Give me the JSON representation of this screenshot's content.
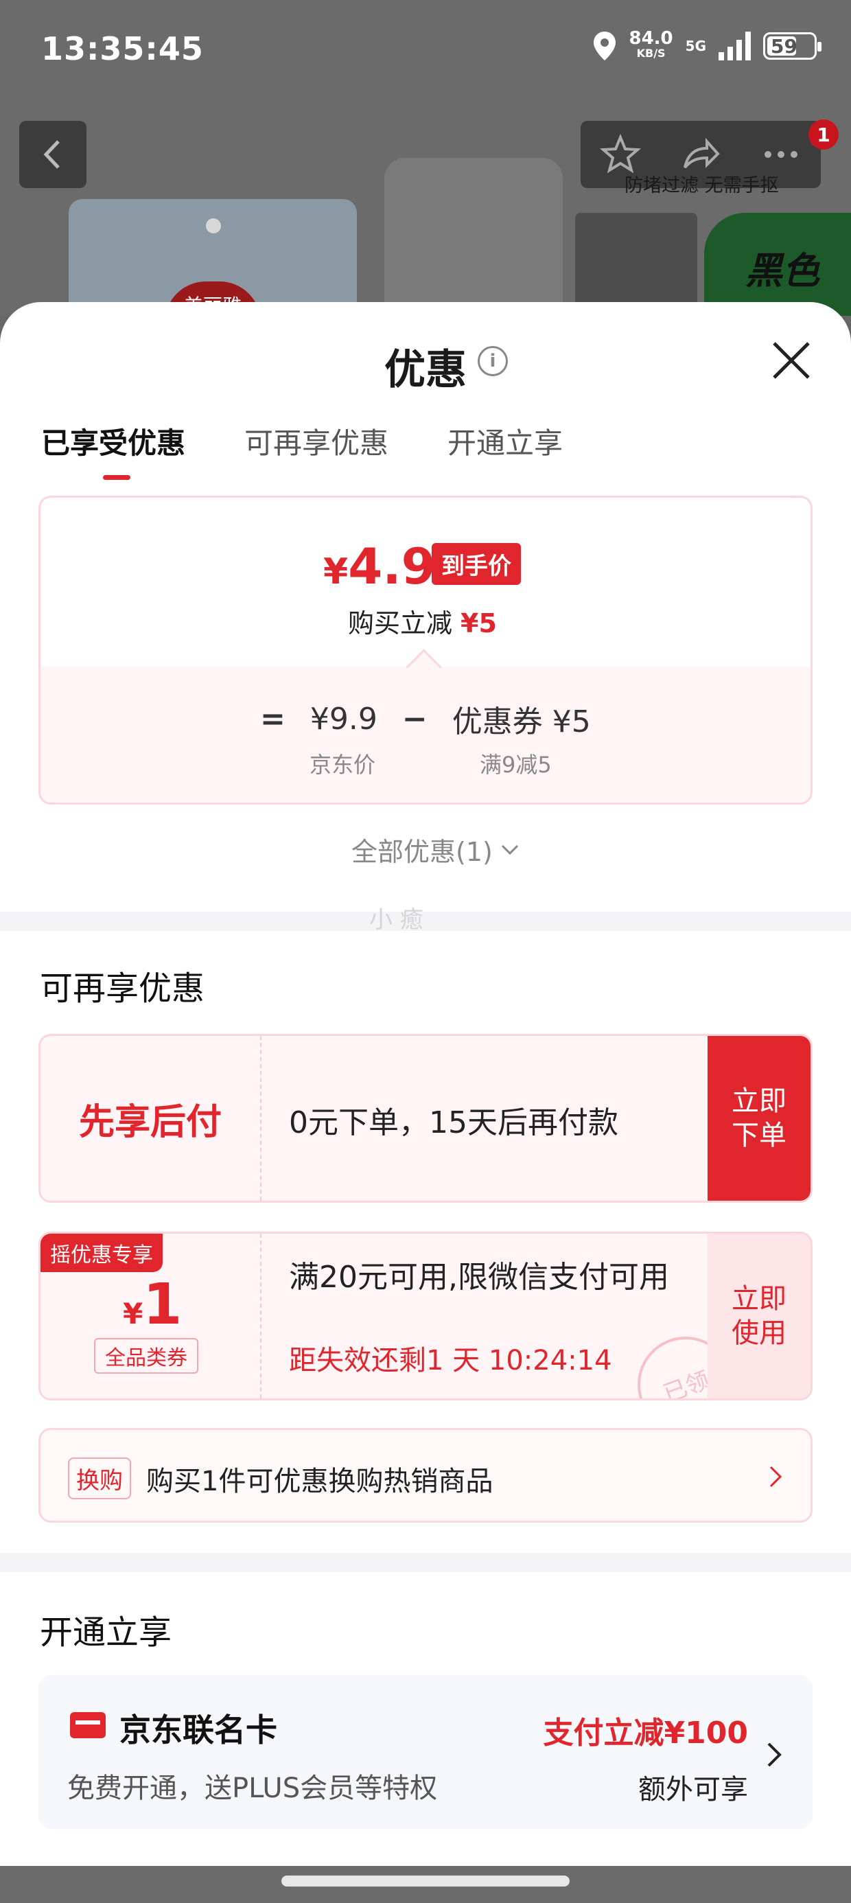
{
  "status_bar": {
    "time": "13:35:45",
    "net_speed": "84.0",
    "net_unit": "KB/S",
    "network": "5G",
    "battery": "59"
  },
  "background_page": {
    "overlay_caption": "防堵过滤 无需手抠",
    "notification_count": "1",
    "brand_logo_text": "美丽雅",
    "thumb_text": "黑色"
  },
  "sheet": {
    "title": "优惠",
    "tabs": [
      {
        "label": "已享受优惠",
        "active": true
      },
      {
        "label": "可再享优惠",
        "active": false
      },
      {
        "label": "开通立享",
        "active": false
      }
    ]
  },
  "price_card": {
    "currency": "¥",
    "final_price": "4.9",
    "price_tag": "到手价",
    "reduce_label": "购买立减",
    "reduce_amount": "¥5",
    "eq": "=",
    "minus": "−",
    "jd_price": "¥9.9",
    "jd_price_label": "京东价",
    "coupon": "优惠券 ¥5",
    "coupon_rule": "满9减5"
  },
  "all_discounts": "全部优惠(1)",
  "watermark": "小 癒",
  "section_more": {
    "title": "可再享优惠",
    "pay_later": {
      "label": "先享后付",
      "desc": "0元下单，15天后再付款",
      "action_line1": "立即",
      "action_line2": "下单"
    },
    "coupon": {
      "ribbon": "摇优惠专享",
      "currency": "¥",
      "amount": "1",
      "scope": "全品类券",
      "desc": "满20元可用,限微信支付可用",
      "countdown": "距失效还剩1 天 10:24:14",
      "stamp": "已领",
      "action_line1": "立即",
      "action_line2": "使用"
    },
    "exchange": {
      "tag": "换购",
      "text": "购买1件可优惠换购热销商品"
    }
  },
  "section_open": {
    "title": "开通立享",
    "card_name": "京东联名卡",
    "card_sub": "免费开通，送PLUS会员等特权",
    "promo": "支付立减¥100",
    "promo_sub": "额外可享"
  }
}
